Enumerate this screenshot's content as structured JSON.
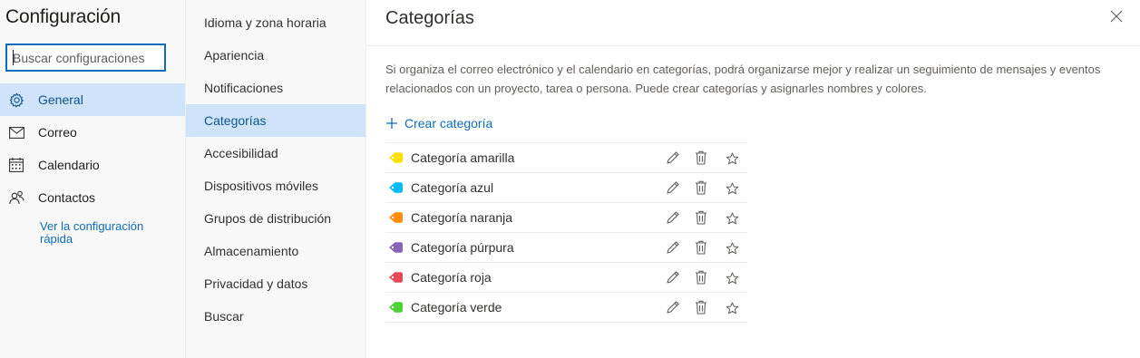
{
  "sidebar": {
    "title": "Configuración",
    "search_placeholder": "Buscar configuraciones",
    "items": [
      {
        "label": "General",
        "icon": "gear-icon",
        "active": true
      },
      {
        "label": "Correo",
        "icon": "mail-icon",
        "active": false
      },
      {
        "label": "Calendario",
        "icon": "calendar-icon",
        "active": false
      },
      {
        "label": "Contactos",
        "icon": "people-icon",
        "active": false
      }
    ],
    "quick_link": "Ver la configuración rápida"
  },
  "subnav": {
    "items": [
      {
        "label": "Idioma y zona horaria",
        "active": false
      },
      {
        "label": "Apariencia",
        "active": false
      },
      {
        "label": "Notificaciones",
        "active": false
      },
      {
        "label": "Categorías",
        "active": true
      },
      {
        "label": "Accesibilidad",
        "active": false
      },
      {
        "label": "Dispositivos móviles",
        "active": false
      },
      {
        "label": "Grupos de distribución",
        "active": false
      },
      {
        "label": "Almacenamiento",
        "active": false
      },
      {
        "label": "Privacidad y datos",
        "active": false
      },
      {
        "label": "Buscar",
        "active": false
      }
    ]
  },
  "main": {
    "title": "Categorías",
    "description": "Si organiza el correo electrónico y el calendario en categorías, podrá organizarse mejor y realizar un seguimiento de mensajes y eventos relacionados con un proyecto, tarea o persona. Puede crear categorías y asignarles nombres y colores.",
    "create_label": "Crear categoría",
    "categories": [
      {
        "name": "Categoría amarilla",
        "color": "#fce100"
      },
      {
        "name": "Categoría azul",
        "color": "#00bcf2"
      },
      {
        "name": "Categoría naranja",
        "color": "#ff8c00"
      },
      {
        "name": "Categoría púrpura",
        "color": "#8764b8"
      },
      {
        "name": "Categoría roja",
        "color": "#e74856"
      },
      {
        "name": "Categoría verde",
        "color": "#4cd137"
      }
    ]
  },
  "colors": {
    "accent": "#0f6cbd",
    "active_bg": "#cfe4fa"
  }
}
